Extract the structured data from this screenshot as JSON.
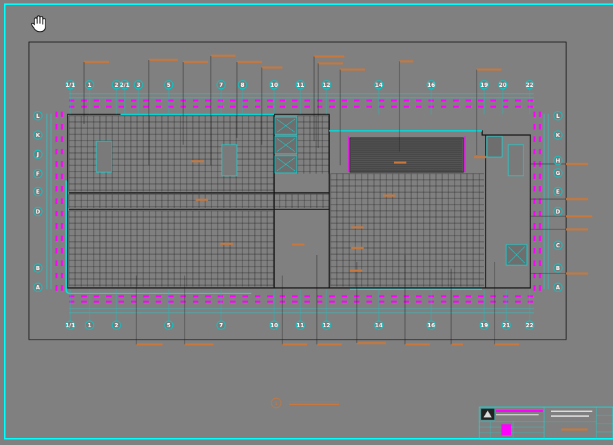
{
  "viewport": {
    "background": "#808080",
    "frame_color": "#00ffff"
  },
  "tool": {
    "icon": "hand-pan-icon"
  },
  "colors": {
    "paper_line": "#111111",
    "cyan": "#00e8e8",
    "magenta": "#ff00ff",
    "orange": "#c8783c",
    "grid_line": "#1a1a1a",
    "bubble": "#00cccc"
  },
  "grid_axes": {
    "top": [
      "1/1",
      "1",
      "2",
      "2/1",
      "3",
      "5",
      "7",
      "8",
      "10",
      "11",
      "12",
      "14",
      "16",
      "19",
      "20",
      "22"
    ],
    "bottom": [
      "1/1",
      "1",
      "2",
      "5",
      "7",
      "10",
      "11",
      "12",
      "14",
      "16",
      "19",
      "21",
      "22"
    ],
    "left": [
      "L",
      "K",
      "J",
      "F",
      "E",
      "D",
      "B",
      "A"
    ],
    "right": [
      "L",
      "K",
      "H",
      "G",
      "E",
      "D",
      "C",
      "B",
      "A"
    ]
  },
  "drawing_title": {
    "number": "1",
    "text": "",
    "scale": ""
  },
  "title_block": {
    "logo": "company-logo-icon",
    "company": "",
    "project": "",
    "sheet": ""
  }
}
